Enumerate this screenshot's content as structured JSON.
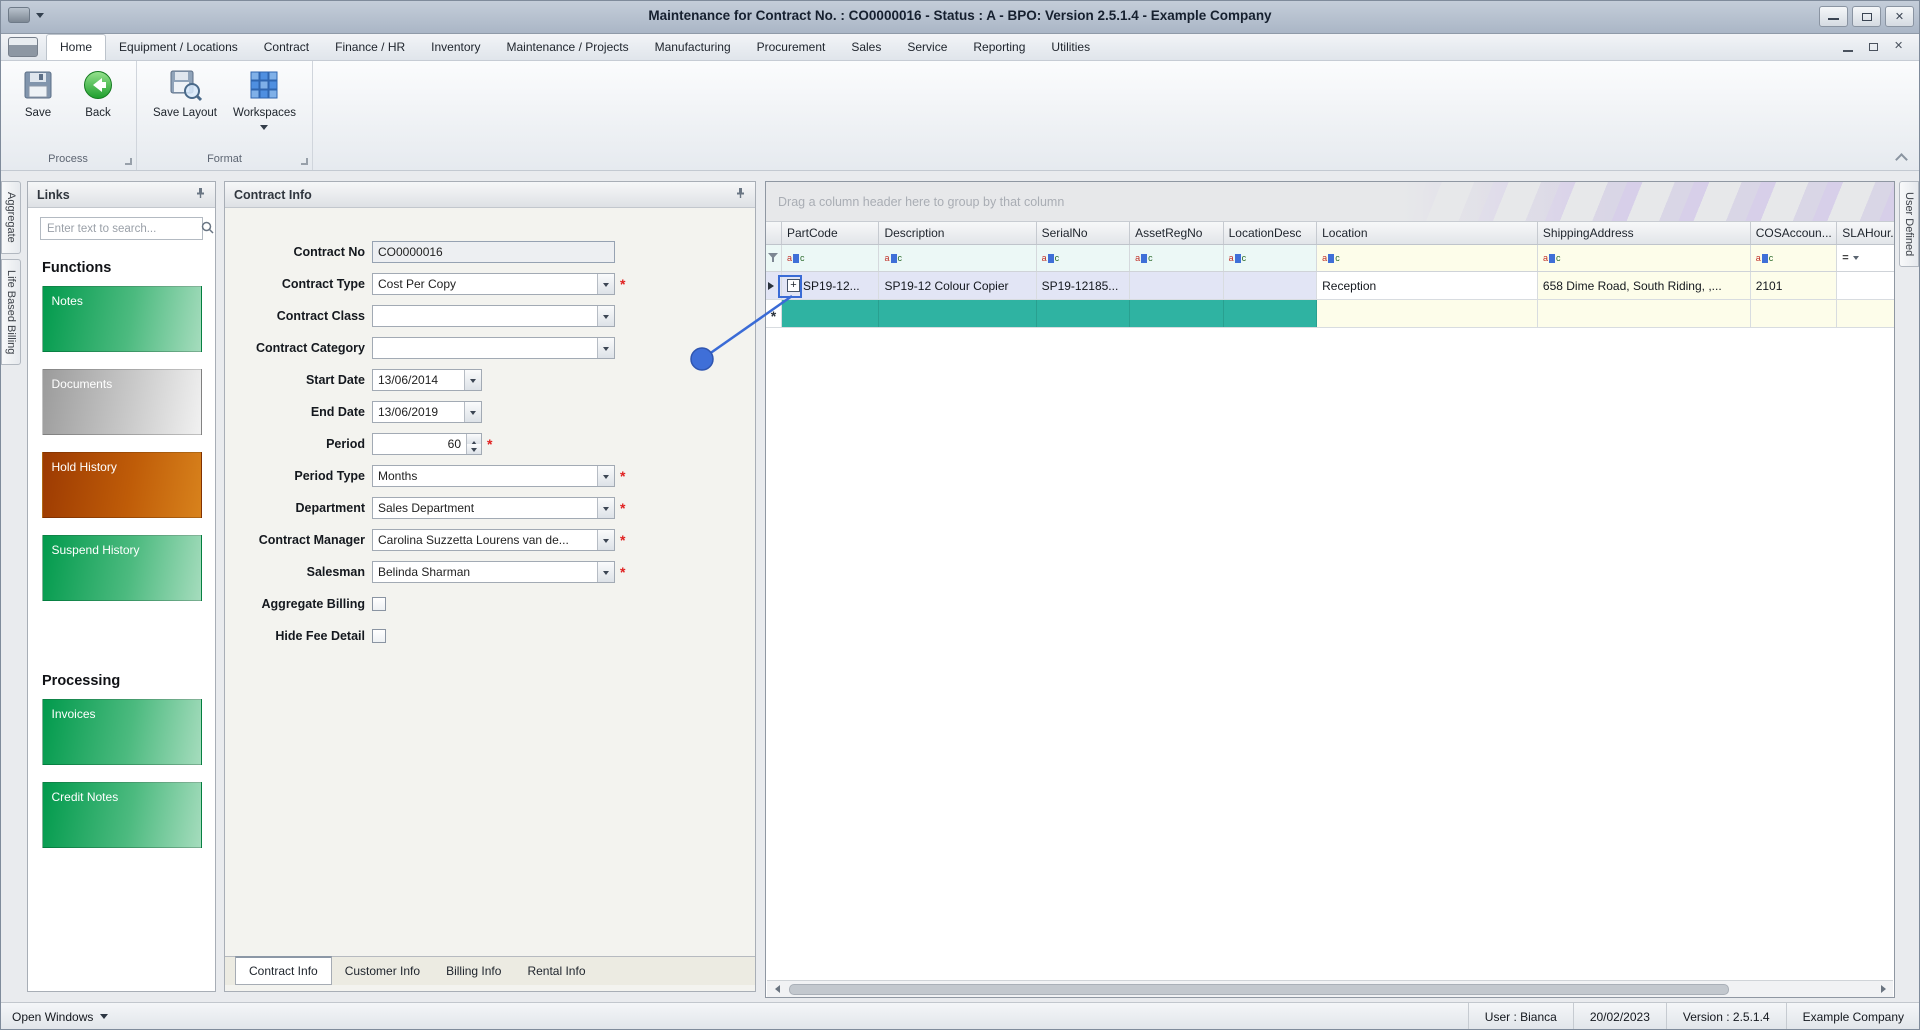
{
  "window": {
    "title": "Maintenance for Contract No. : CO0000016 - Status : A - BPO: Version 2.5.1.4 - Example Company"
  },
  "menu": {
    "tabs": [
      {
        "label": "Home",
        "active": true
      },
      {
        "label": "Equipment / Locations"
      },
      {
        "label": "Contract"
      },
      {
        "label": "Finance / HR"
      },
      {
        "label": "Inventory"
      },
      {
        "label": "Maintenance / Projects"
      },
      {
        "label": "Manufacturing"
      },
      {
        "label": "Procurement"
      },
      {
        "label": "Sales"
      },
      {
        "label": "Service"
      },
      {
        "label": "Reporting"
      },
      {
        "label": "Utilities"
      }
    ]
  },
  "ribbon": {
    "groups": [
      {
        "label": "Process",
        "buttons": [
          {
            "label": "Save"
          },
          {
            "label": "Back"
          }
        ]
      },
      {
        "label": "Format",
        "buttons": [
          {
            "label": "Save Layout"
          },
          {
            "label": "Workspaces"
          }
        ]
      }
    ]
  },
  "dock": {
    "left": [
      "Aggregate",
      "Life Based Billing"
    ],
    "right": [
      "User Defined"
    ]
  },
  "links_panel": {
    "title": "Links",
    "search_placeholder": "Enter text to search...",
    "sections": [
      {
        "heading": "Functions",
        "buttons": [
          {
            "label": "Notes",
            "style": "green"
          },
          {
            "label": "Documents",
            "style": "gray"
          },
          {
            "label": "Hold History",
            "style": "orange"
          },
          {
            "label": "Suspend History",
            "style": "green"
          }
        ]
      },
      {
        "heading": "Processing",
        "buttons": [
          {
            "label": "Invoices",
            "style": "green"
          },
          {
            "label": "Credit Notes",
            "style": "green"
          }
        ]
      }
    ]
  },
  "contract_panel": {
    "title": "Contract Info",
    "fields": [
      {
        "label": "Contract No",
        "value": "CO0000016",
        "required": false
      },
      {
        "label": "Contract Type",
        "value": "Cost Per Copy",
        "required": true
      },
      {
        "label": "Contract Class",
        "value": "",
        "required": false
      },
      {
        "label": "Contract Category",
        "value": "",
        "required": false
      },
      {
        "label": "Start Date",
        "value": "13/06/2014",
        "required": false
      },
      {
        "label": "End Date",
        "value": "13/06/2019",
        "required": false
      },
      {
        "label": "Period",
        "value": "60",
        "required": true
      },
      {
        "label": "Period Type",
        "value": "Months",
        "required": true
      },
      {
        "label": "Department",
        "value": "Sales Department",
        "required": true
      },
      {
        "label": "Contract Manager",
        "value": "Carolina Suzzetta Lourens van de...",
        "required": true
      },
      {
        "label": "Salesman",
        "value": "Belinda Sharman",
        "required": true
      },
      {
        "label": "Aggregate Billing",
        "value": "",
        "required": false
      },
      {
        "label": "Hide Fee Detail",
        "value": "",
        "required": false
      }
    ],
    "tabs": [
      {
        "label": "Contract Info",
        "active": true
      },
      {
        "label": "Customer Info"
      },
      {
        "label": "Billing Info"
      },
      {
        "label": "Rental Info"
      }
    ]
  },
  "grid": {
    "group_hint": "Drag a column header here to group by that column",
    "columns": [
      "PartCode",
      "Description",
      "SerialNo",
      "AssetRegNo",
      "LocationDesc",
      "Location",
      "ShippingAddress",
      "COSAccoun...",
      "SLAHour..."
    ],
    "rows": [
      {
        "cells": [
          "SP19-12...",
          "SP19-12 Colour Copier",
          "SP19-12185...",
          "",
          "",
          "Reception",
          "658 Dime Road, South Riding, ,...",
          "2101",
          ""
        ]
      }
    ]
  },
  "status_bar": {
    "open_windows": "Open Windows",
    "items": [
      "User : Bianca",
      "20/02/2023",
      "Version : 2.5.1.4",
      "Example Company"
    ]
  },
  "colors": {
    "annotation_blue": "#3a6bd6",
    "new_row_teal": "#2fb3a2",
    "link_green": "#019a4c",
    "hold_orange": "#9c3a02",
    "required_red": "#e02020"
  }
}
